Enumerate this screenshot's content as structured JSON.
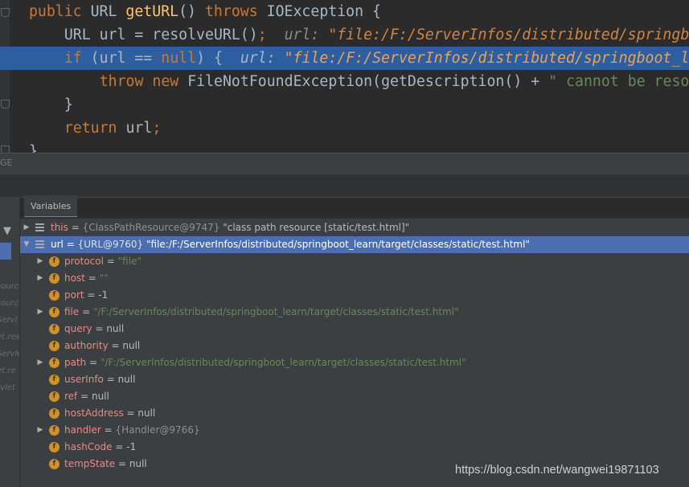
{
  "editor": {
    "lines": [
      {
        "indent": "  ",
        "parts": [
          [
            "kw",
            "public "
          ],
          [
            "plain",
            "URL "
          ],
          [
            "fn",
            "getURL"
          ],
          [
            "plain",
            "() "
          ],
          [
            "kw",
            "throws "
          ],
          [
            "plain",
            "IOException {"
          ]
        ]
      },
      {
        "indent": "      ",
        "parts": [
          [
            "plain",
            "URL url = resolveURL()"
          ],
          [
            "kw",
            ";"
          ],
          [
            "hint",
            "  url: "
          ],
          [
            "hstr",
            "\"file:/F:/ServerInfos/distributed/springboot_learn/target/classes/static/test.html\""
          ]
        ]
      },
      {
        "indent": "      ",
        "parts": [
          [
            "kw",
            "if "
          ],
          [
            "plain",
            "(url == "
          ],
          [
            "kw",
            "null"
          ],
          [
            "plain",
            ") {  "
          ],
          [
            "hint",
            "url: "
          ],
          [
            "hstr",
            "\"file:/F:/ServerInfos/distributed/springboot_learn/target/classes/static/test.html\""
          ]
        ]
      },
      {
        "indent": "          ",
        "parts": [
          [
            "kw",
            "throw new "
          ],
          [
            "plain",
            "FileNotFoundException(getDescription() + "
          ],
          [
            "str",
            "\" cannot be resolved to URL because it does not exist\""
          ],
          [
            "plain",
            ");"
          ]
        ]
      },
      {
        "indent": "      ",
        "parts": [
          [
            "plain",
            "}"
          ]
        ]
      },
      {
        "indent": "      ",
        "parts": [
          [
            "kw",
            "return "
          ],
          [
            "plain",
            "url"
          ],
          [
            "kw",
            ";"
          ]
        ]
      },
      {
        "indent": "  ",
        "parts": [
          [
            "plain",
            "}"
          ]
        ]
      }
    ]
  },
  "debugger": {
    "splitter_label": "GE",
    "variables_tab": "Variables",
    "frames": [
      "source,",
      "source,",
      "Servl",
      "et.res",
      "Servle",
      "et.re",
      "rvlet"
    ],
    "variables": [
      {
        "depth": 0,
        "arrow": "right",
        "icon": "list",
        "name": "this",
        "type": "{ClassPathResource@9747}",
        "value": "\"class path resource [static/test.html]\"",
        "vclass": "plain",
        "selected": false
      },
      {
        "depth": 0,
        "arrow": "down",
        "icon": "list",
        "name": "url",
        "type": "{URL@9760}",
        "value": "\"file:/F:/ServerInfos/distributed/springboot_learn/target/classes/static/test.html\"",
        "vclass": "plain",
        "selected": true
      },
      {
        "depth": 1,
        "arrow": "right",
        "icon": "field",
        "name": "protocol",
        "type": "",
        "value": "\"file\"",
        "vclass": "str",
        "selected": false
      },
      {
        "depth": 1,
        "arrow": "right",
        "icon": "field",
        "name": "host",
        "type": "",
        "value": "\"\"",
        "vclass": "str",
        "selected": false
      },
      {
        "depth": 1,
        "arrow": "",
        "icon": "field",
        "name": "port",
        "type": "",
        "value": "-1",
        "vclass": "plain",
        "selected": false
      },
      {
        "depth": 1,
        "arrow": "right",
        "icon": "field",
        "name": "file",
        "type": "",
        "value": "\"/F:/ServerInfos/distributed/springboot_learn/target/classes/static/test.html\"",
        "vclass": "str",
        "selected": false
      },
      {
        "depth": 1,
        "arrow": "",
        "icon": "field",
        "name": "query",
        "type": "",
        "value": "null",
        "vclass": "plain",
        "selected": false
      },
      {
        "depth": 1,
        "arrow": "",
        "icon": "field",
        "name": "authority",
        "type": "",
        "value": "null",
        "vclass": "plain",
        "selected": false
      },
      {
        "depth": 1,
        "arrow": "right",
        "icon": "field",
        "name": "path",
        "type": "",
        "value": "\"/F:/ServerInfos/distributed/springboot_learn/target/classes/static/test.html\"",
        "vclass": "str",
        "selected": false
      },
      {
        "depth": 1,
        "arrow": "",
        "icon": "field",
        "name": "userInfo",
        "type": "",
        "value": "null",
        "vclass": "plain",
        "selected": false
      },
      {
        "depth": 1,
        "arrow": "",
        "icon": "field",
        "name": "ref",
        "type": "",
        "value": "null",
        "vclass": "plain",
        "selected": false
      },
      {
        "depth": 1,
        "arrow": "",
        "icon": "field",
        "name": "hostAddress",
        "type": "",
        "value": "null",
        "vclass": "plain",
        "selected": false
      },
      {
        "depth": 1,
        "arrow": "right",
        "icon": "field",
        "name": "handler",
        "type": "{Handler@9766}",
        "value": "",
        "vclass": "plain",
        "selected": false
      },
      {
        "depth": 1,
        "arrow": "",
        "icon": "field",
        "name": "hashCode",
        "type": "",
        "value": "-1",
        "vclass": "plain",
        "selected": false
      },
      {
        "depth": 1,
        "arrow": "",
        "icon": "field",
        "name": "tempState",
        "type": "",
        "value": "null",
        "vclass": "plain",
        "selected": false
      }
    ]
  },
  "watermark": "https://blog.csdn.net/wangwei19871103"
}
